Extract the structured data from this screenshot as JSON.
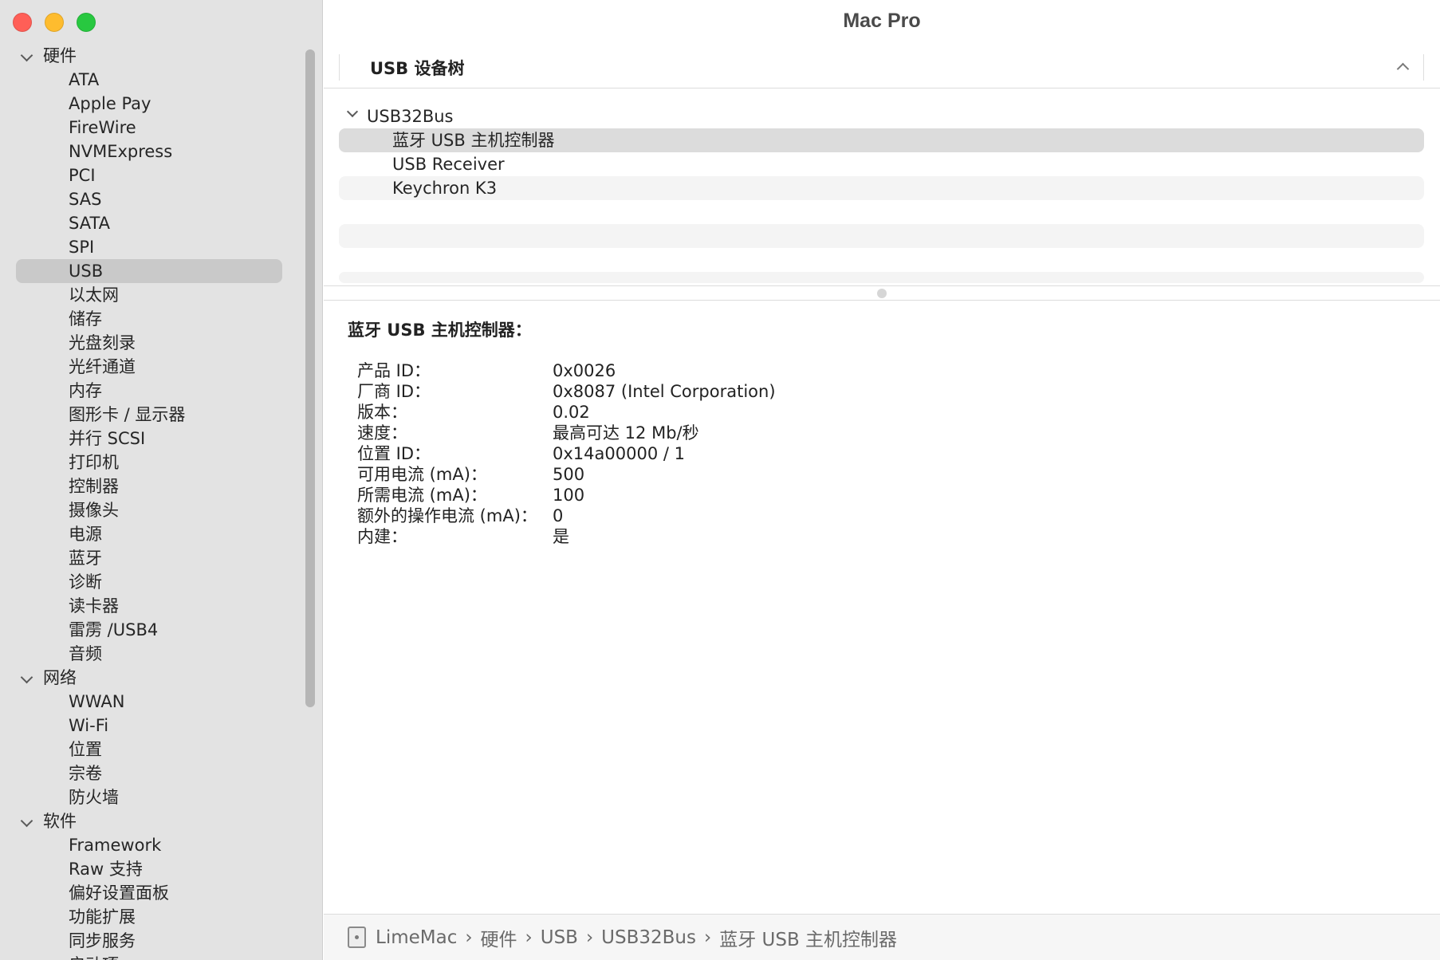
{
  "window": {
    "title": "Mac Pro"
  },
  "sidebar": {
    "categories": [
      {
        "label": "硬件",
        "items": [
          "ATA",
          "Apple Pay",
          "FireWire",
          "NVMExpress",
          "PCI",
          "SAS",
          "SATA",
          "SPI",
          "USB",
          "以太网",
          "储存",
          "光盘刻录",
          "光纤通道",
          "内存",
          "图形卡 / 显示器",
          "并行 SCSI",
          "打印机",
          "控制器",
          "摄像头",
          "电源",
          "蓝牙",
          "诊断",
          "读卡器",
          "雷雳 /USB4",
          "音频"
        ]
      },
      {
        "label": "网络",
        "items": [
          "WWAN",
          "Wi-Fi",
          "位置",
          "宗卷",
          "防火墙"
        ]
      },
      {
        "label": "软件",
        "items": [
          "Framework",
          "Raw 支持",
          "偏好设置面板",
          "功能扩展",
          "同步服务",
          "启动项"
        ]
      }
    ],
    "selected": "USB"
  },
  "usb_tree": {
    "header": "USB 设备树",
    "bus": "USB32Bus",
    "devices": [
      "蓝牙 USB 主机控制器",
      "USB Receiver",
      "Keychron K3"
    ],
    "selected": "蓝牙 USB 主机控制器"
  },
  "detail": {
    "title": "蓝牙 USB 主机控制器：",
    "properties": [
      {
        "key": "产品 ID：",
        "value": "0x0026"
      },
      {
        "key": "厂商 ID：",
        "value": "0x8087  (Intel Corporation)"
      },
      {
        "key": "版本：",
        "value": "0.02"
      },
      {
        "key": "速度：",
        "value": "最高可达 12 Mb/秒"
      },
      {
        "key": "位置 ID：",
        "value": "0x14a00000 / 1"
      },
      {
        "key": "可用电流 (mA)：",
        "value": "500"
      },
      {
        "key": "所需电流 (mA)：",
        "value": "100"
      },
      {
        "key": "额外的操作电流 (mA)：",
        "value": "0"
      },
      {
        "key": "内建：",
        "value": "是"
      }
    ]
  },
  "pathbar": {
    "icon": "mac-pro-icon",
    "crumbs": [
      "LimeMac",
      "硬件",
      "USB",
      "USB32Bus",
      "蓝牙 USB 主机控制器"
    ]
  },
  "colors": {
    "close": "#ff5f57",
    "minimize": "#febc2e",
    "zoom": "#28c840",
    "sidebar_bg": "#e3e3e3",
    "selection": "#c9c9c9"
  }
}
